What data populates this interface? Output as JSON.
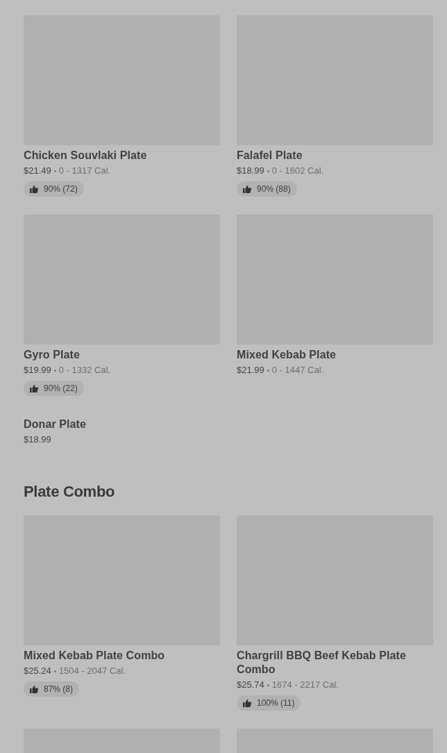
{
  "sections": [
    {
      "items": [
        {
          "has_image": true,
          "title": "Chicken Souvlaki Plate",
          "price": "$21.49",
          "calories": "0 - 1317 Cal.",
          "rating": "90% (72)"
        },
        {
          "has_image": true,
          "title": "Falafel Plate",
          "price": "$18.99",
          "calories": "0 - 1602 Cal.",
          "rating": "90% (88)"
        },
        {
          "has_image": true,
          "title": "Gyro Plate",
          "price": "$19.99",
          "calories": "0 - 1332 Cal.",
          "rating": "90% (22)"
        },
        {
          "has_image": true,
          "title": "Mixed Kebab Plate",
          "price": "$21.99",
          "calories": "0 - 1447 Cal."
        },
        {
          "has_image": false,
          "title": "Donar Plate",
          "price": "$18.99"
        }
      ]
    },
    {
      "heading": "Plate Combo",
      "items": [
        {
          "has_image": true,
          "title": "Mixed Kebab Plate Combo",
          "price": "$25.24",
          "calories": "1504 - 2047 Cal.",
          "rating": "87% (8)"
        },
        {
          "has_image": true,
          "title": "Chargrill BBQ Beef Kebab Plate Combo",
          "price": "$25.74",
          "calories": "1674 - 2217 Cal.",
          "rating": "100% (11)"
        },
        {
          "has_image": true
        },
        {
          "has_image": true
        }
      ]
    }
  ]
}
